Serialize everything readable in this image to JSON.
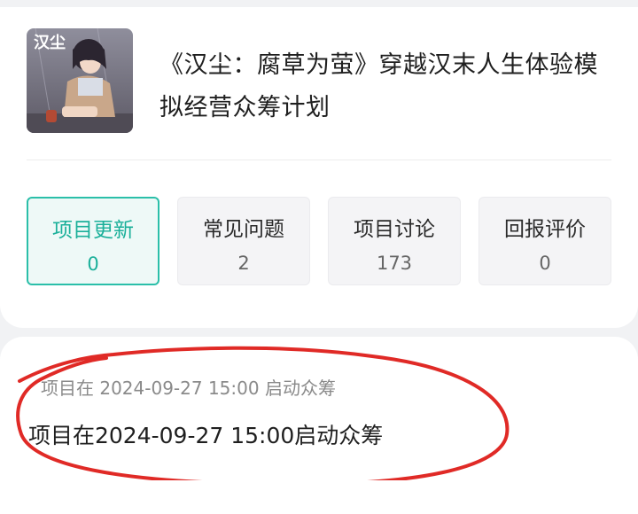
{
  "project": {
    "thumbnail_text": "汉尘",
    "title": "《汉尘：腐草为萤》穿越汉末人生体验模拟经营众筹计划"
  },
  "tabs": [
    {
      "label": "项目更新",
      "count": "0",
      "active": true
    },
    {
      "label": "常见问题",
      "count": "2",
      "active": false
    },
    {
      "label": "项目讨论",
      "count": "173",
      "active": false
    },
    {
      "label": "回报评价",
      "count": "0",
      "active": false
    }
  ],
  "update": {
    "meta": "项目在 2024-09-27 15:00 启动众筹",
    "text": "项目在2024-09-27 15:00启动众筹"
  },
  "colors": {
    "accent": "#1bb09a",
    "annotation": "#e02a26"
  }
}
